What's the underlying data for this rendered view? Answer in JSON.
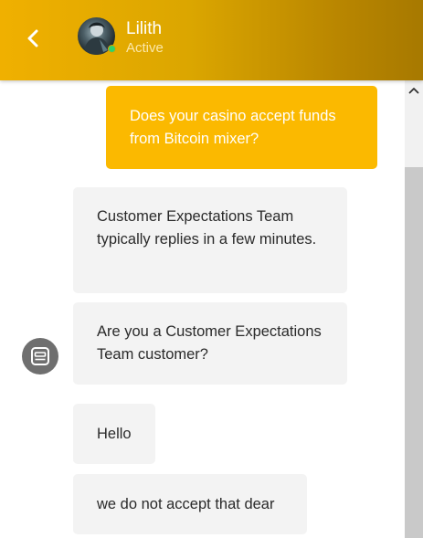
{
  "header": {
    "agent_name": "Lilith",
    "agent_status": "Active",
    "back_icon": "chevron-left-icon"
  },
  "messages": [
    {
      "from": "user",
      "text": "Does your casino accept funds from Bitcoin mixer?"
    },
    {
      "from": "agent",
      "text": "Customer Expectations Team typically replies in a few minutes."
    },
    {
      "from": "agent",
      "text": "Are you a Customer Expectations Team customer?"
    },
    {
      "from": "agent",
      "text": "Hello"
    },
    {
      "from": "agent",
      "text": "we do not accept that dear"
    }
  ],
  "colors": {
    "header_start": "#f0b000",
    "header_end": "#a77900",
    "user_bubble": "#fbb900",
    "agent_bubble": "#f3f3f3",
    "online_dot": "#2fd36a"
  }
}
